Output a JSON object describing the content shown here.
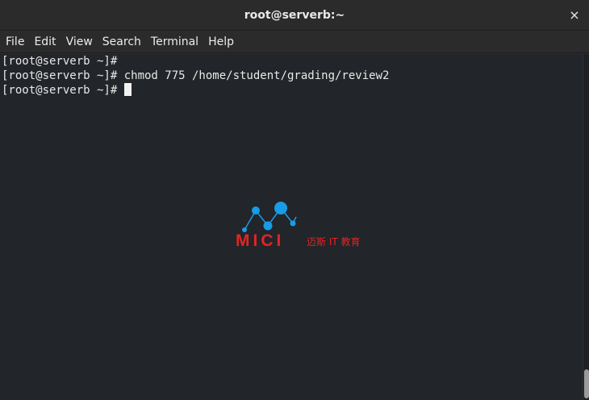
{
  "window": {
    "title": "root@serverb:~",
    "close_glyph": "×"
  },
  "menu": [
    "File",
    "Edit",
    "View",
    "Search",
    "Terminal",
    "Help"
  ],
  "terminal": {
    "lines": [
      "[root@serverb ~]#",
      "[root@serverb ~]# chmod 775 /home/student/grading/review2",
      "[root@serverb ~]# "
    ]
  },
  "watermark": {
    "brand": "MICI",
    "subtitle": "迈斯 IT 教育",
    "colors": {
      "brand": "#e32424",
      "dots": "#1a9be6"
    }
  }
}
